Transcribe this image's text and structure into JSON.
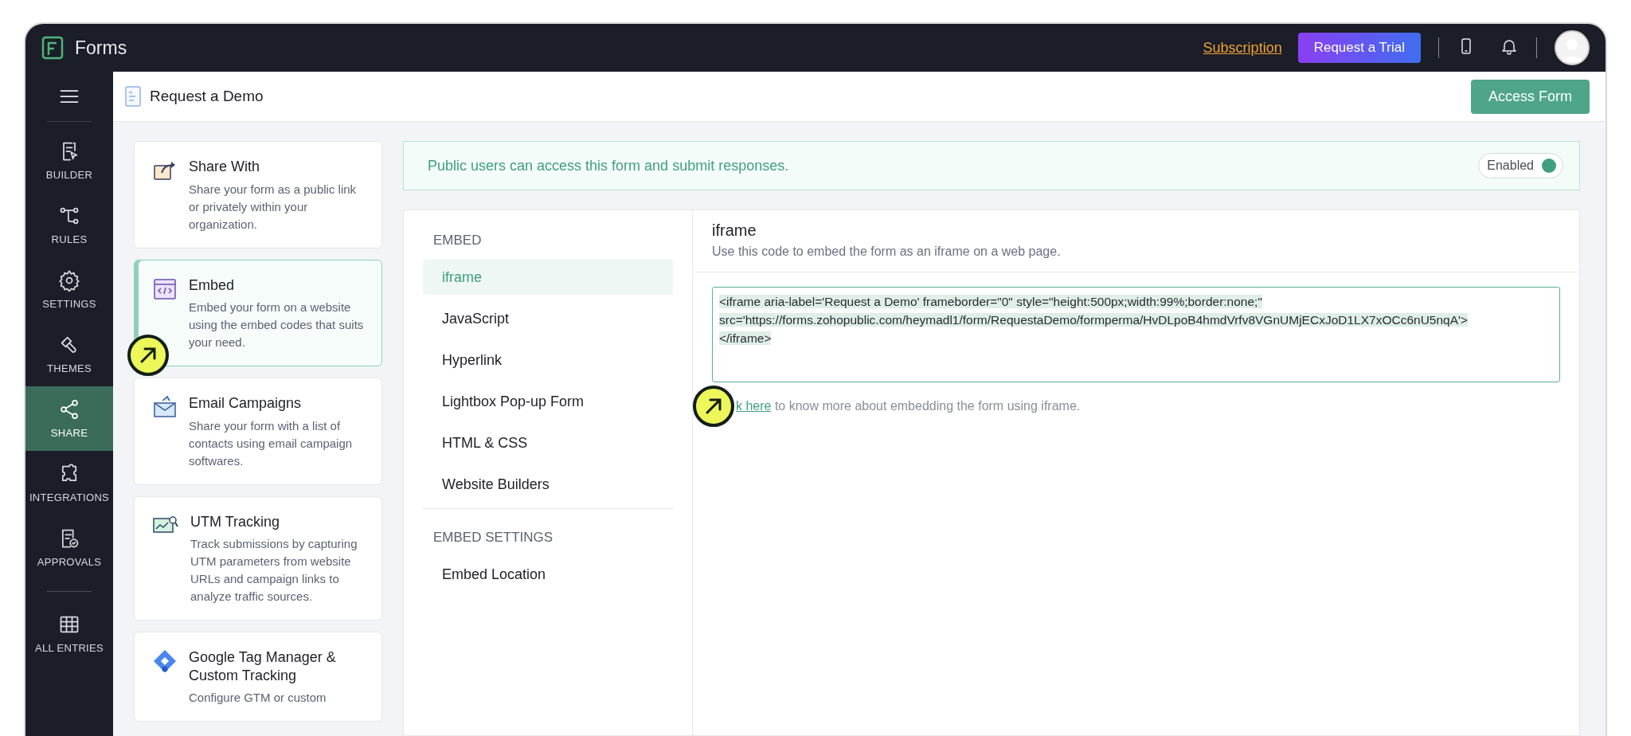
{
  "app": {
    "name": "Forms"
  },
  "top_bar": {
    "subscription_link": "Subscription",
    "trial_button": "Request a Trial"
  },
  "header": {
    "title": "Request a Demo",
    "access_button": "Access Form"
  },
  "sidebar": {
    "items": [
      {
        "kind": "builder",
        "label": "BUILDER",
        "selected": false
      },
      {
        "kind": "rules",
        "label": "RULES",
        "selected": false
      },
      {
        "kind": "settings",
        "label": "SETTINGS",
        "selected": false
      },
      {
        "kind": "themes",
        "label": "THEMES",
        "selected": false
      },
      {
        "kind": "share",
        "label": "SHARE",
        "selected": true
      },
      {
        "kind": "integrations",
        "label": "INTEGRATIONS",
        "selected": false
      },
      {
        "kind": "approvals",
        "label": "APPROVALS",
        "selected": false
      },
      {
        "kind": "entries",
        "label": "ALL ENTRIES",
        "selected": false
      }
    ]
  },
  "cards": [
    {
      "kind": "share",
      "title": "Share With",
      "description": "Share your form as a public link or privately within your organization.",
      "selected": false
    },
    {
      "kind": "embed",
      "title": "Embed",
      "description": "Embed your form on a website using the embed codes that suits your need.",
      "selected": true
    },
    {
      "kind": "email",
      "title": "Email Campaigns",
      "description": "Share your form with a list of contacts using email campaign softwares.",
      "selected": false
    },
    {
      "kind": "utm",
      "title": "UTM Tracking",
      "description": "Track submissions by capturing UTM parameters from website URLs and campaign links to analyze traffic sources.",
      "selected": false
    },
    {
      "kind": "gtm",
      "title": "Google Tag Manager & Custom Tracking",
      "description": "Configure GTM or custom",
      "selected": false
    }
  ],
  "banner": {
    "message": "Public users can access this form and submit responses.",
    "toggle": {
      "label": "Enabled",
      "on": true
    }
  },
  "menu": {
    "sections": [
      {
        "heading": "EMBED",
        "items": [
          {
            "label": "iframe",
            "selected": true
          },
          {
            "label": "JavaScript",
            "selected": false
          },
          {
            "label": "Hyperlink",
            "selected": false
          },
          {
            "label": "Lightbox Pop-up Form",
            "selected": false
          },
          {
            "label": "HTML & CSS",
            "selected": false
          },
          {
            "label": "Website Builders",
            "selected": false
          }
        ]
      },
      {
        "heading": "EMBED SETTINGS",
        "items": [
          {
            "label": "Embed Location",
            "selected": false
          }
        ]
      }
    ]
  },
  "detail": {
    "title": "iframe",
    "subtitle": "Use this code to embed the form as an iframe on a web page.",
    "code": {
      "highlighted": true,
      "lines": [
        "<iframe aria-label='Request a Demo' frameborder=\"0\" style=\"height:500px;width:99%;border:none;\"",
        "src='https://forms.zohopublic.com/heymadl1/form/RequestaDemo/formperma/HvDLpoB4hmdVrfv8VGnUMjECxJoD1LX7xOCc6nU5nqA'>",
        "</iframe>"
      ]
    },
    "help_link": "k here",
    "help_text": "to know more about embedding the form using iframe."
  }
}
